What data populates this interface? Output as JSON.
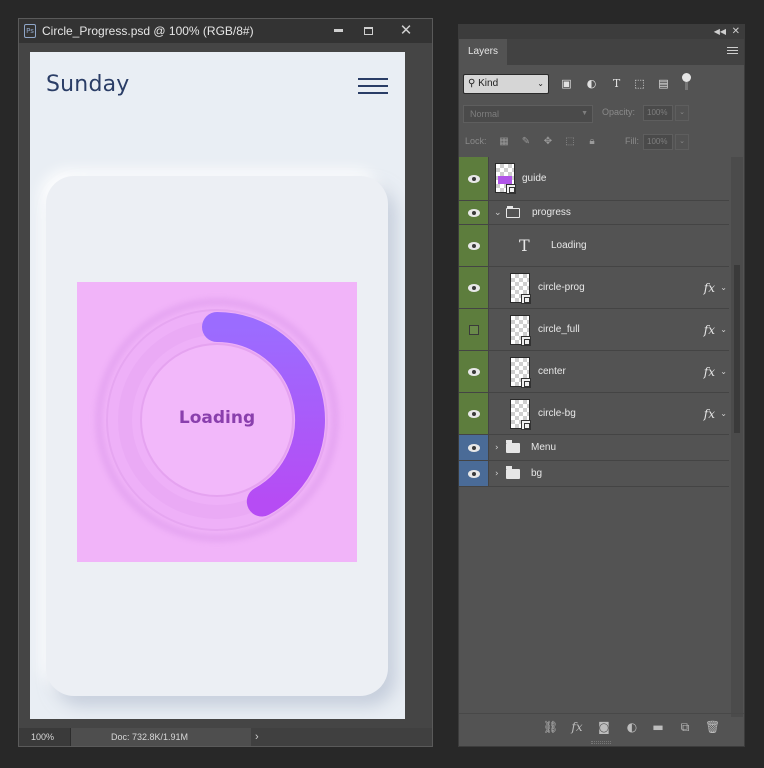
{
  "document": {
    "title": "Circle_Progress.psd @ 100% (RGB/8#)",
    "ps_badge": "Ps",
    "zoom": "100%",
    "doc_info": "Doc: 732.8K/1.91M",
    "controls": {
      "minimize": "",
      "maximize": "",
      "close": "✕"
    }
  },
  "canvas": {
    "app_title": "Sunday",
    "card_colors": {
      "background": "#e9eef4",
      "guide": "#f1b4f9",
      "accent_start": "#9b6cff",
      "accent_end": "#b64cf4",
      "text": "#8a3fad"
    },
    "progress": {
      "label": "Loading",
      "value": 0.42
    }
  },
  "layers_panel": {
    "tab": "Layers",
    "filter_kind": "Kind",
    "blend_mode": "Normal",
    "opacity_label": "Opacity:",
    "opacity_value": "100%",
    "lock_label": "Lock:",
    "fill_label": "Fill:",
    "fill_value": "100%",
    "layers": [
      {
        "name": "guide",
        "visible": true,
        "kind": "smart-object",
        "fx": false
      },
      {
        "name": "progress",
        "visible": true,
        "kind": "group-open",
        "fx": false
      },
      {
        "name": "Loading",
        "visible": true,
        "kind": "text",
        "fx": false
      },
      {
        "name": "circle-prog",
        "visible": true,
        "kind": "smart-object",
        "fx": true
      },
      {
        "name": "circle_full",
        "visible": false,
        "kind": "smart-object",
        "fx": true
      },
      {
        "name": "center",
        "visible": true,
        "kind": "smart-object",
        "fx": true
      },
      {
        "name": "circle-bg",
        "visible": true,
        "kind": "smart-object",
        "fx": true
      },
      {
        "name": "Menu",
        "visible": true,
        "kind": "group-closed",
        "fx": false
      },
      {
        "name": "bg",
        "visible": true,
        "kind": "group-closed",
        "fx": false
      }
    ],
    "fx_label": "fx"
  }
}
